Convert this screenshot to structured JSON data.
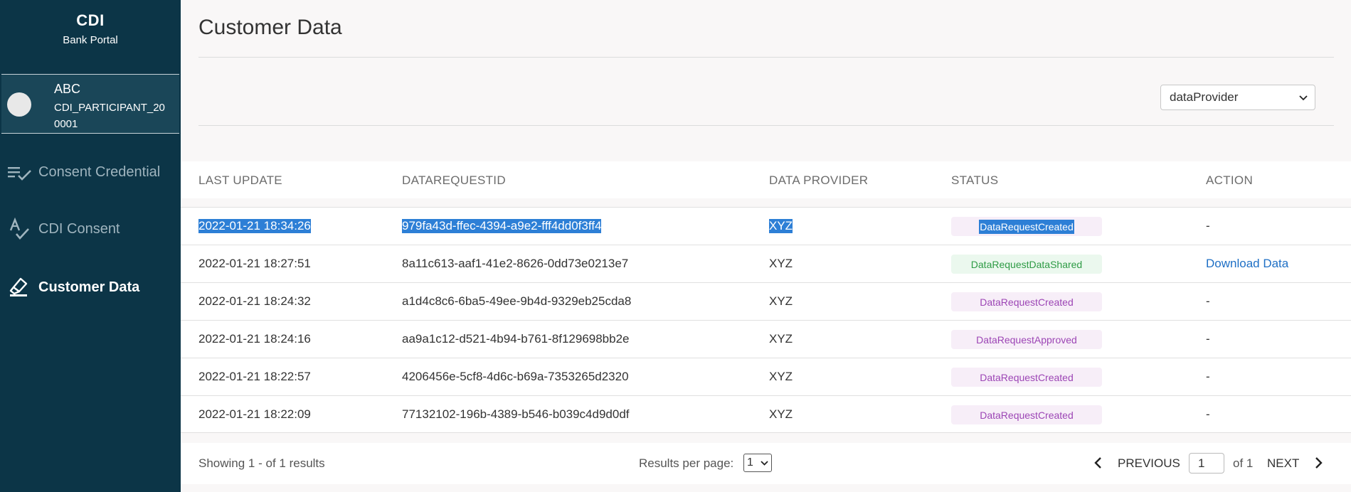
{
  "sidebar": {
    "brand_title": "CDI",
    "brand_subtitle": "Bank Portal",
    "user_name": "ABC",
    "user_id": "CDI_PARTICIPANT_200001",
    "nav": [
      {
        "label": "Consent Credential",
        "icon": "checklist-icon"
      },
      {
        "label": "CDI Consent",
        "icon": "spellcheck-icon"
      },
      {
        "label": "Customer Data",
        "icon": "eraser-icon"
      }
    ],
    "active_nav": "Customer Data"
  },
  "main": {
    "title": "Customer Data",
    "filter_value": "dataProvider"
  },
  "table": {
    "headers": [
      "LAST UPDATE",
      "DATAREQUESTID",
      "DATA PROVIDER",
      "STATUS",
      "ACTION"
    ],
    "rows": [
      {
        "date": "2022-01-21 18:34:26",
        "id": "979fa43d-ffec-4394-a9e2-fff4dd0f3ff4",
        "provider": "XYZ",
        "status": "DataRequestCreated",
        "action": "-"
      },
      {
        "date": "2022-01-21 18:27:51",
        "id": "8a11c613-aaf1-41e2-8626-0dd73e0213e7",
        "provider": "XYZ",
        "status": "DataRequestDataShared",
        "action": "Download Data"
      },
      {
        "date": "2022-01-21 18:24:32",
        "id": "a1d4c8c6-6ba5-49ee-9b4d-9329eb25cda8",
        "provider": "XYZ",
        "status": "DataRequestCreated",
        "action": "-"
      },
      {
        "date": "2022-01-21 18:24:16",
        "id": "aa9a1c12-d521-4b94-b761-8f129698bb2e",
        "provider": "XYZ",
        "status": "DataRequestApproved",
        "action": "-"
      },
      {
        "date": "2022-01-21 18:22:57",
        "id": "4206456e-5cf8-4d6c-b69a-7353265d2320",
        "provider": "XYZ",
        "status": "DataRequestCreated",
        "action": "-"
      },
      {
        "date": "2022-01-21 18:22:09",
        "id": "77132102-196b-4389-b546-b039c4d9d0df",
        "provider": "XYZ",
        "status": "DataRequestCreated",
        "action": "-"
      }
    ]
  },
  "footer": {
    "showing": "Showing 1 - of 1 results",
    "results_per_page_label": "Results per page:",
    "results_per_page_value": "1",
    "previous_label": "PREVIOUS",
    "page_value": "1",
    "of_label": "of 1",
    "next_label": "NEXT"
  },
  "colors": {
    "sidebar_bg": "#0c3547",
    "selection": "#2d7fd6",
    "status_purple": "#9c45b5",
    "status_green": "#2e9b45",
    "link": "#1e6fc5"
  }
}
